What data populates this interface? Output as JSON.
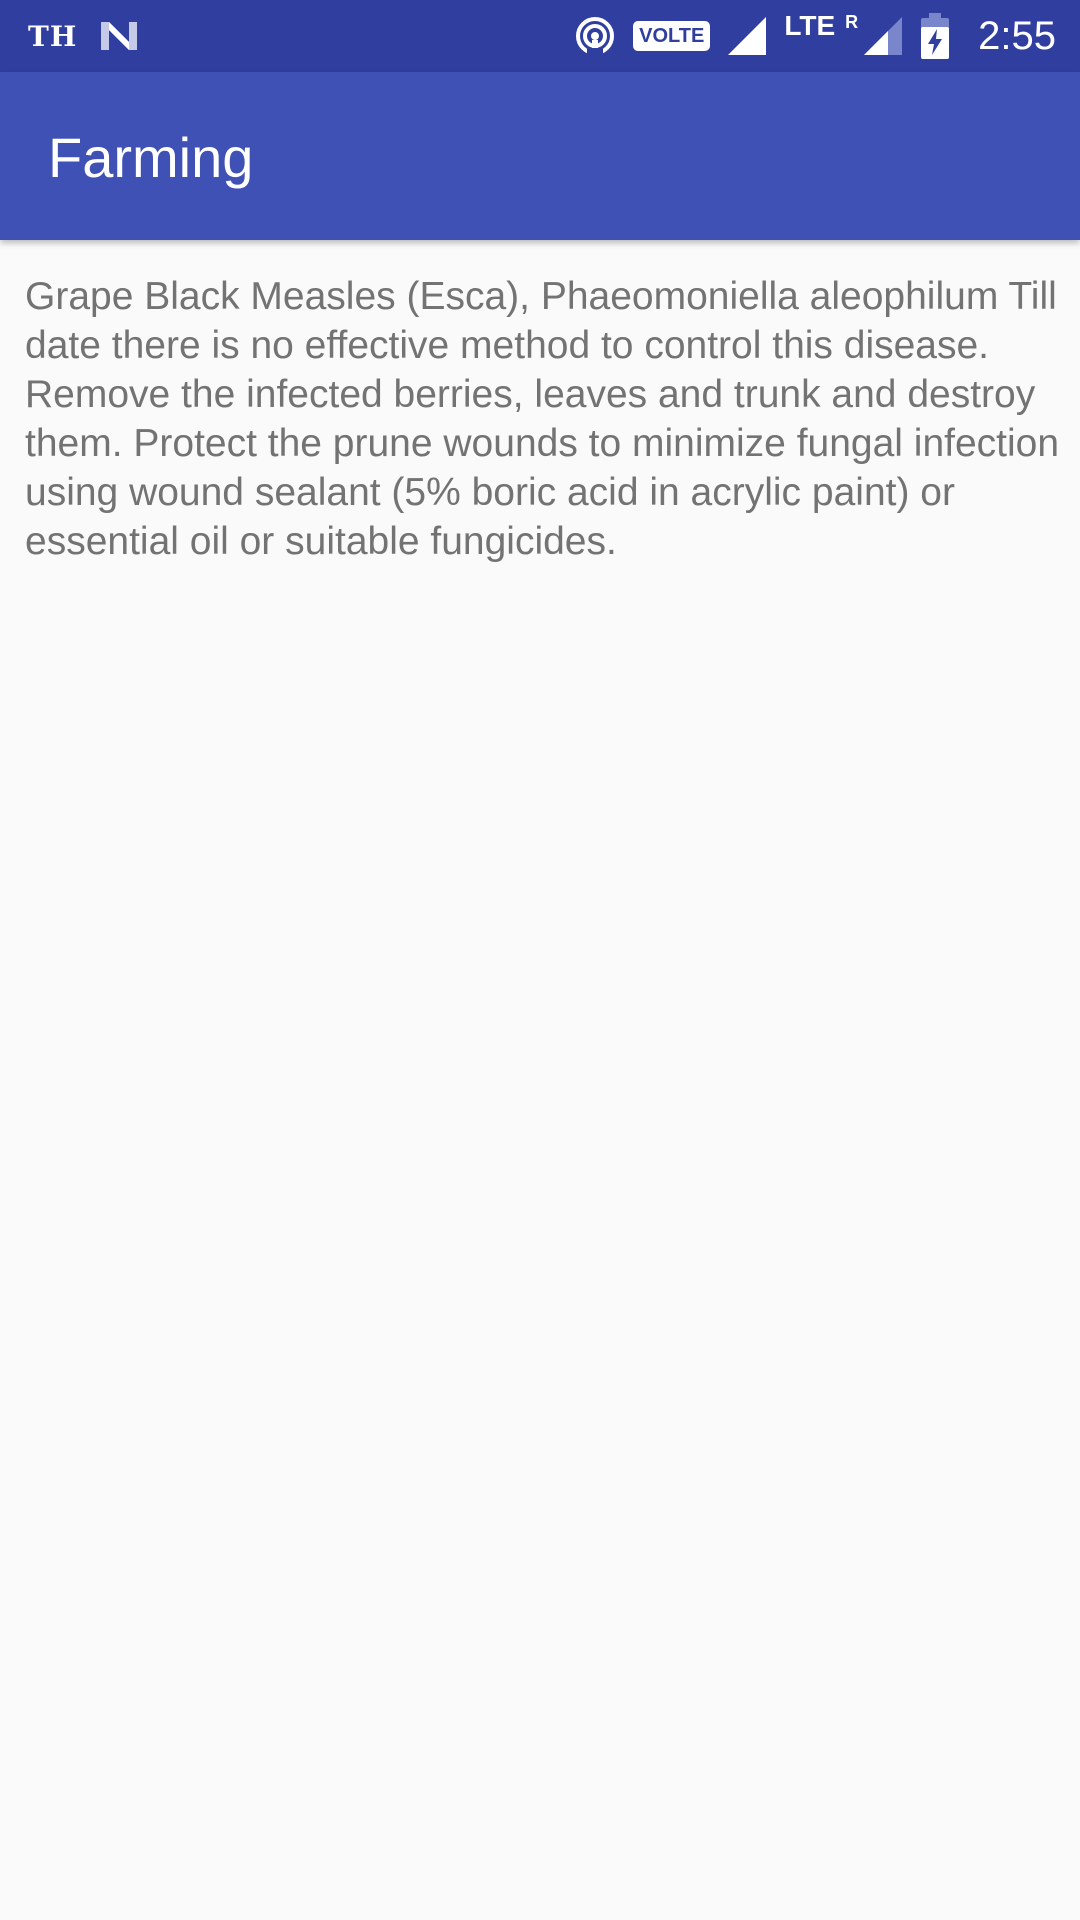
{
  "status_bar": {
    "carrier_label": "TH",
    "network_badge": "VOLTE",
    "network_type": "LTE",
    "roaming_indicator": "R",
    "time": "2:55",
    "icons": [
      "n-logo-icon",
      "hotspot-icon",
      "signal-icon",
      "roaming-signal-icon",
      "battery-charging-icon"
    ],
    "background_color": "#303f9f"
  },
  "app_bar": {
    "title": "Farming",
    "background_color": "#3f51b5"
  },
  "content": {
    "description": "Grape Black Measles (Esca), Phaeomoniella aleophilum Till date there is no effective method to control this disease. Remove the infected berries, leaves and trunk and destroy them. Protect the prune wounds to minimize fungal infection using wound sealant (5% boric acid in acrylic paint) or essential oil or suitable fungicides.",
    "text_color": "#737373"
  }
}
